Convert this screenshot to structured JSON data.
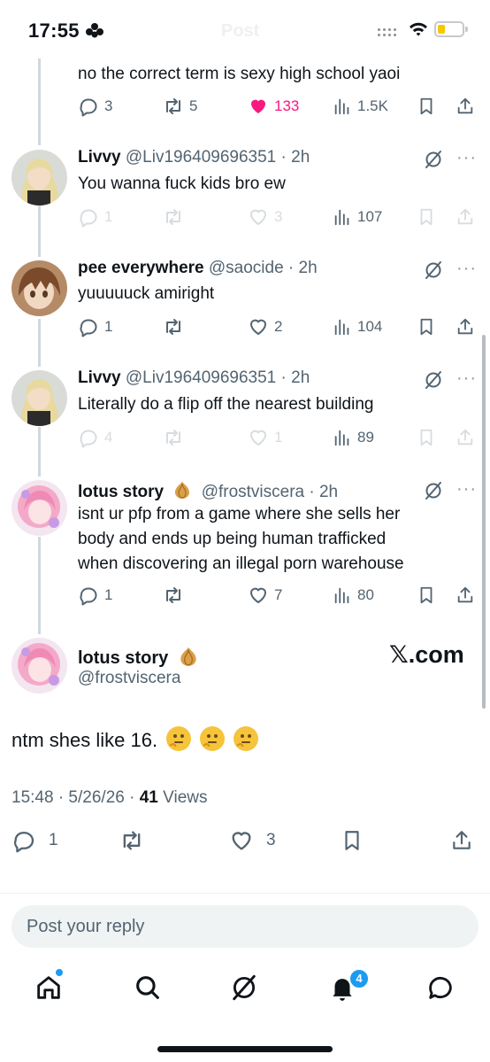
{
  "status_bar": {
    "time": "17:55",
    "ghost_title": "Post"
  },
  "replies": [
    {
      "text": "no the correct term is sexy high school yaoi",
      "actions": {
        "replies": "3",
        "reposts": "5",
        "likes": "133",
        "views": "1.5K"
      }
    },
    {
      "name": "Livvy",
      "handle": "@Liv196409696351",
      "time": " · 2h",
      "text": "You wanna fuck kids bro ew",
      "actions": {
        "replies": "1",
        "reposts": "",
        "likes": "3",
        "views": "107"
      }
    },
    {
      "name": "pee everywhere",
      "handle": "@saocide",
      "time": " · 2h",
      "text": "yuuuuuck amiright",
      "actions": {
        "replies": "1",
        "reposts": "",
        "likes": "2",
        "views": "104"
      }
    },
    {
      "name": "Livvy",
      "handle": "@Liv196409696351",
      "time": " · 2h",
      "text": "Literally do a flip off the nearest building",
      "actions": {
        "replies": "4",
        "reposts": "",
        "likes": "1",
        "views": "89"
      }
    },
    {
      "name": "lotus story",
      "handle": "@frostviscera",
      "time": " · 2h",
      "text_lines": [
        "isnt ur pfp from a game where she sells her",
        "body and ends up being human trafficked",
        "when discovering an illegal porn warehouse"
      ],
      "actions": {
        "replies": "1",
        "reposts": "",
        "likes": "7",
        "views": "80"
      }
    }
  ],
  "main_post": {
    "name": "lotus story",
    "handle": "@frostviscera",
    "watermark": "𝕏.com",
    "text": "ntm shes like 16.",
    "time": "15:48 · 5/26/26 · ",
    "views_count": "41",
    "views_label": " Views",
    "actions": {
      "replies": "1",
      "reposts": "",
      "likes": "3"
    }
  },
  "reply_placeholder": "Post your reply",
  "notifications_badge": "4",
  "colors": {
    "like": "#f91880",
    "accent": "#1d9bf0",
    "text": "#0f1419",
    "secondary": "#536471"
  },
  "icons": [
    "reply-icon",
    "repost-icon",
    "like-icon",
    "views-icon",
    "bookmark-icon",
    "share-icon",
    "grok-icon",
    "more-icon",
    "onion-emoji",
    "thinking-emoji",
    "home-icon",
    "search-icon",
    "grok-tab-icon",
    "bell-icon",
    "messages-icon"
  ]
}
